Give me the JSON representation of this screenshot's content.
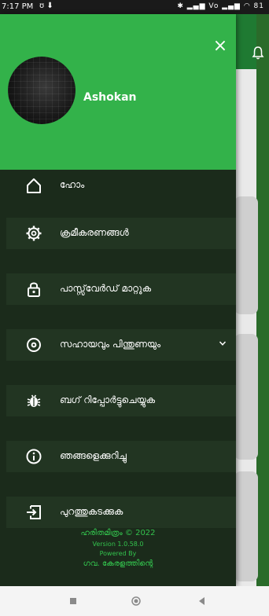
{
  "status_bar": {
    "time": "7:17 PM",
    "left_icons": "ʊ ⬇",
    "right_icons": "✱ ▂▄▆ Vo ▂▄▆ ◠ 81"
  },
  "drawer": {
    "user_name": "Ashokan",
    "close_icon": "×",
    "menu_items": [
      {
        "label": "ഹോം",
        "icon": "home-icon"
      },
      {
        "label": "ക്രമീകരണങ്ങൾ",
        "icon": "settings-gear-icon"
      },
      {
        "label": "പാസ്സ്‌വേർഡ് മാറ്റുക",
        "icon": "lock-icon"
      },
      {
        "label": "സഹായവും പിന്തുണയും",
        "icon": "help-support-icon",
        "has_chevron": true
      },
      {
        "label": "ബഗ് റിപ്പോർട്ടുചെയ്യുക",
        "icon": "bug-icon"
      },
      {
        "label": "ഞങ്ങളെക്കുറിച്ചു",
        "icon": "info-icon"
      },
      {
        "label": "പുറത്തുകടക്കുക",
        "icon": "logout-icon"
      }
    ],
    "footer": {
      "app_copyright": "ഹരിതമിത്രം © 2022",
      "version": "Version 1.0.58.0",
      "powered_by": "Powered By",
      "org": "ഗവ. കേരളത്തിന്റെ"
    }
  },
  "colors": {
    "header_green": "#33b24a",
    "drawer_bg": "#1b2b1b",
    "menu_item_bg": "#223522",
    "footer_text": "#33c24d"
  },
  "nav_bar": {
    "buttons": [
      "recent-apps-icon",
      "home-button-icon",
      "back-icon"
    ]
  }
}
